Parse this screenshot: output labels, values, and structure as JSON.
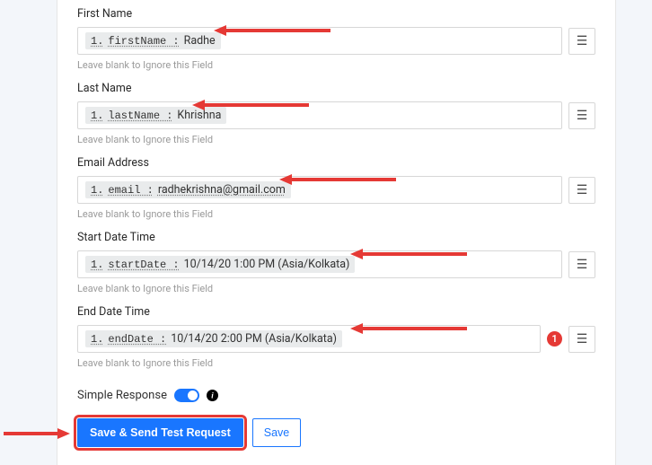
{
  "hints": {
    "blank": "Leave blank to Ignore this Field"
  },
  "fields": {
    "firstName": {
      "label": "First Name",
      "tokenNum": "1.",
      "tokenKey": "firstName :",
      "tokenVal": "Radhe"
    },
    "lastName": {
      "label": "Last Name",
      "tokenNum": "1.",
      "tokenKey": "lastName :",
      "tokenVal": "Khrishna"
    },
    "email": {
      "label": "Email Address",
      "tokenNum": "1.",
      "tokenKey": "email :",
      "tokenVal": "radhekrishna@gmail.com"
    },
    "startDate": {
      "label": "Start Date Time",
      "tokenNum": "1.",
      "tokenKey": "startDate :",
      "tokenVal": "10/14/20 1:00 PM (Asia/Kolkata)"
    },
    "endDate": {
      "label": "End Date Time",
      "tokenNum": "1.",
      "tokenKey": "endDate :",
      "tokenVal": "10/14/20 2:00 PM (Asia/Kolkata)",
      "badge": "1"
    }
  },
  "simpleResponse": {
    "label": "Simple Response"
  },
  "buttons": {
    "saveSend": "Save & Send Test Request",
    "save": "Save"
  }
}
